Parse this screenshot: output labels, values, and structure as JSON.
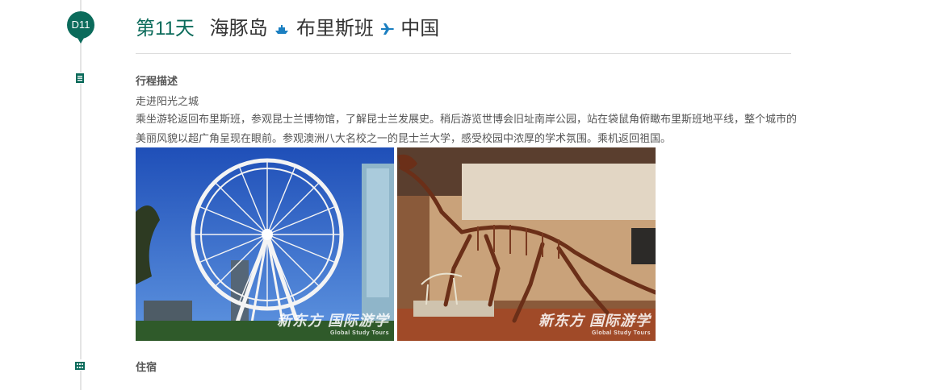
{
  "day": {
    "badge": "D11",
    "number_label": "第11天",
    "route": [
      "海豚岛",
      "布里斯班",
      "中国"
    ],
    "route_icons": [
      "ship-icon",
      "plane-icon"
    ]
  },
  "itinerary": {
    "section_label": "行程描述",
    "subtitle": "走进阳光之城",
    "description": "乘坐游轮返回布里斯班，参观昆士兰博物馆，了解昆士兰发展史。稍后游览世博会旧址南岸公园，站在袋鼠角俯瞰布里斯班地平线，整个城市的美丽风貌以超广角呈现在眼前。参观澳洲八大名校之一的昆士兰大学，感受校园中浓厚的学术氛围。乘机返回祖国。"
  },
  "photos": [
    {
      "subject": "ferris-wheel",
      "watermark": "新东方 国际游学",
      "watermark_sub": "Global Study Tours"
    },
    {
      "subject": "dinosaur-skeleton",
      "watermark": "新东方 国际游学",
      "watermark_sub": "Global Study Tours"
    }
  ],
  "accommodation": {
    "section_label": "住宿"
  },
  "colors": {
    "accent": "#0b6b5b",
    "link_blue": "#1b7fc1"
  }
}
